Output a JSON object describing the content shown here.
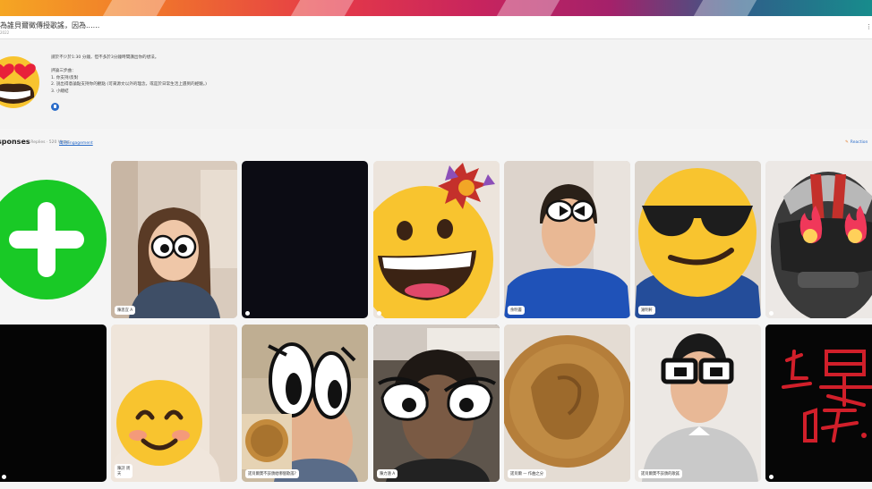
{
  "topbar": {
    "title": "為誰貝爾徵傳授歌謠，因為......",
    "subtitle": "2022",
    "menu": "⋮"
  },
  "prompt": {
    "lines": [
      "請於不少於1:30 分鐘，但不多於3分鐘時間講出你的想法。",
      "",
      "評論三步曲：",
      "1. 你支持/反對",
      "2. 說出得意論點支持你的觀點 (可來源文以外的理念，或是於日常生活上遇到的經驗。)",
      "3. 小總結"
    ]
  },
  "responses": {
    "title": "sponses",
    "count": "3 Replies · 520 Views",
    "link": "萬向Engagement",
    "right_link": "Reaction"
  },
  "tiles": {
    "t1": {
      "name": "陳思宜 A"
    },
    "t5": {
      "name": "余明書"
    },
    "t6": {
      "name": "謝明軒"
    },
    "t8": {
      "name": "陳詩 周",
      "name2": "天"
    },
    "t9": {
      "name": "諾貝爾獎不該頒給哪個歌謠?"
    },
    "t10": {
      "name": "陳力遠 A"
    },
    "t11": {
      "name": "諾貝爾 — 作曲之分"
    },
    "t12": {
      "name": "諾貝爾獎不該頒的歌謠"
    }
  },
  "colors": {
    "accent": "#2a6cc9",
    "plus_green": "#19c926",
    "emoji_yellow": "#f8c42f"
  }
}
